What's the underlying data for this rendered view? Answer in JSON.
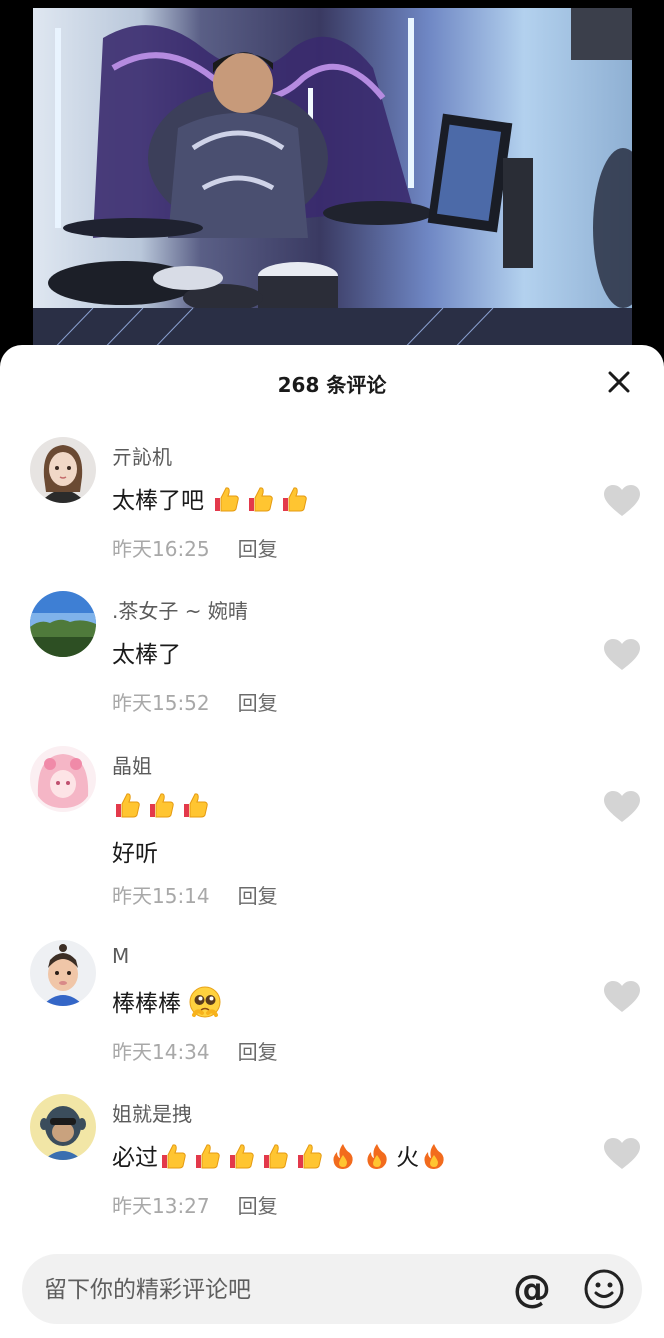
{
  "sheet": {
    "title": "268 条评论"
  },
  "comments": [
    {
      "name": "亓訫机",
      "text": "太棒了吧",
      "time": "昨天16:25",
      "reply": "回复"
    },
    {
      "name": ".茶女子 ~ 婉晴",
      "text": "太棒了",
      "time": "昨天15:52",
      "reply": "回复"
    },
    {
      "name": "晶姐",
      "text": "好听",
      "time": "昨天15:14",
      "reply": "回复"
    },
    {
      "name": "M",
      "text": "棒棒棒",
      "time": "昨天14:34",
      "reply": "回复"
    },
    {
      "name": "姐就是拽",
      "text_a": "必过",
      "text_b": "火",
      "time": "昨天13:27",
      "reply": "回复"
    }
  ],
  "input": {
    "placeholder": "留下你的精彩评论吧"
  },
  "icons": {
    "at": "@",
    "close": "close-icon",
    "heart": "heart-icon",
    "emoji": "smile-icon",
    "thumbs": "thumbs-up-emoji",
    "fire": "fire-emoji",
    "pleading": "pleading-face-emoji"
  },
  "colors": {
    "heart": "#d4d4d4",
    "meta": "#a8a8a8",
    "name": "#5b5b5b"
  }
}
